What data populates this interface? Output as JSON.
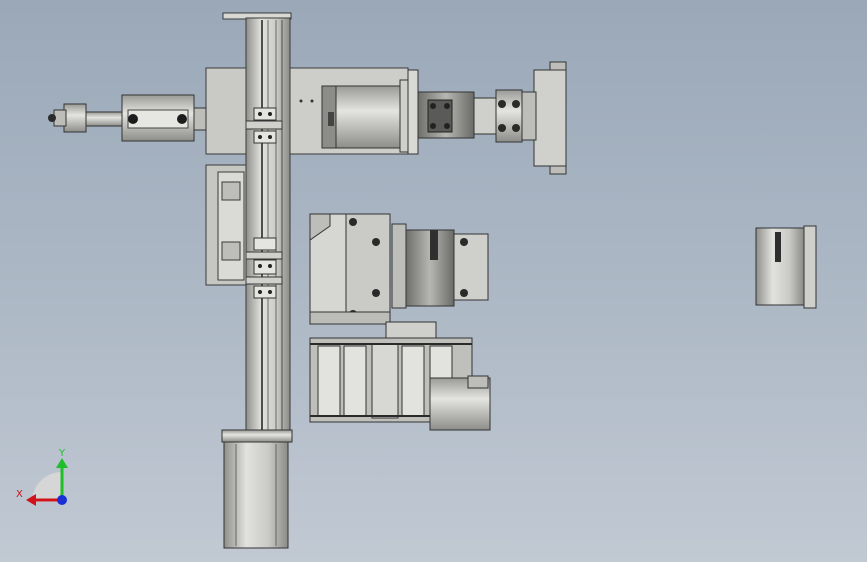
{
  "triad": {
    "x_label": "X",
    "y_label": "Y",
    "colors": {
      "x": "#d0121b",
      "y": "#1fbf2a",
      "z": "#1a2fd6"
    }
  },
  "colors": {
    "background_top": "#9aa8b8",
    "background_bottom": "#c1c9d3",
    "metal_light": "#d4d4d0",
    "metal_mid": "#b9b9b5",
    "metal_dark": "#4a4a4a"
  }
}
